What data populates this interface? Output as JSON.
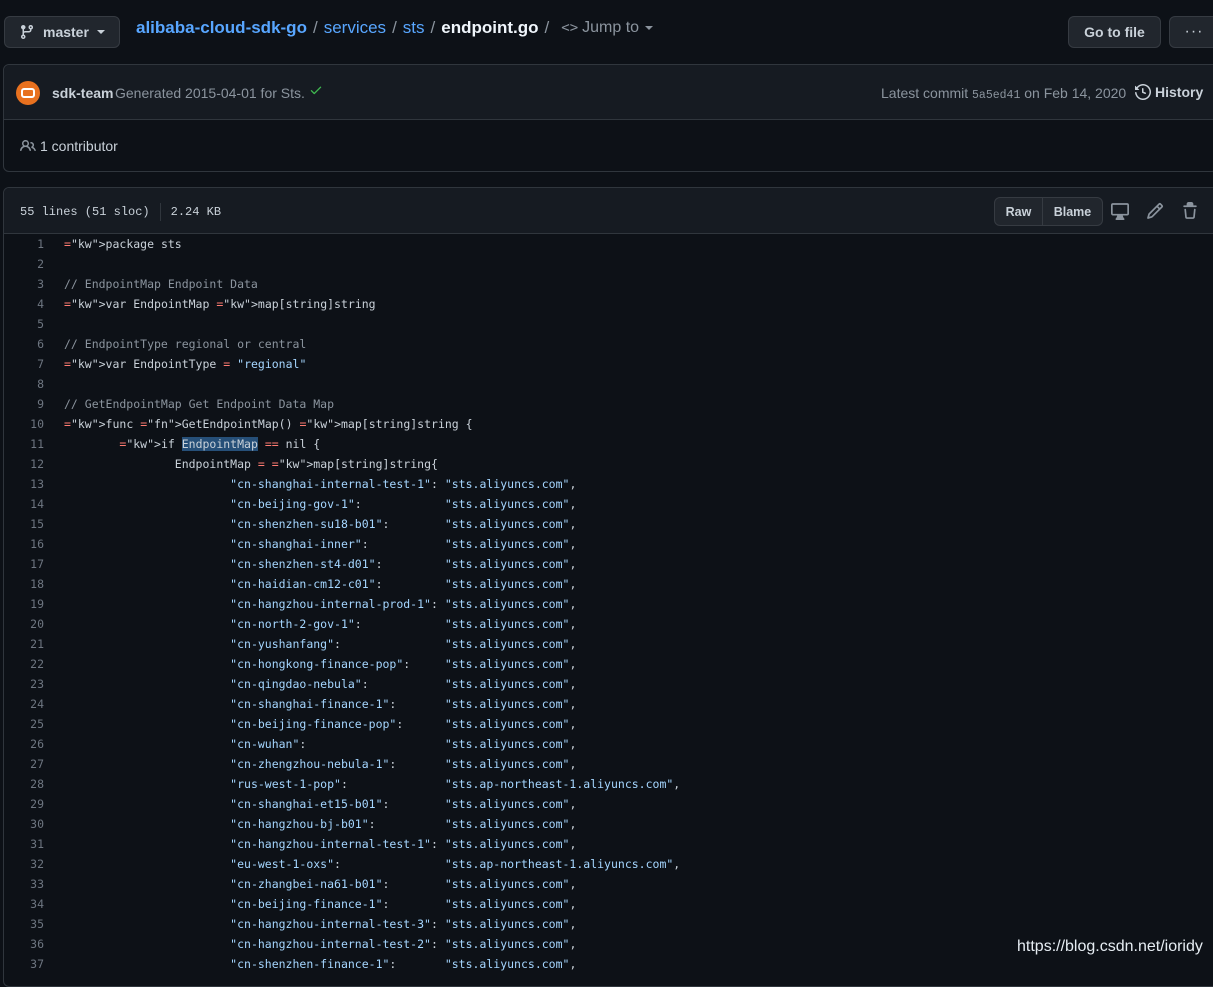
{
  "branch": {
    "label": "master"
  },
  "breadcrumb": {
    "repo": "alibaba-cloud-sdk-go",
    "path1": "services",
    "path2": "sts",
    "file": "endpoint.go",
    "jump_label": "Jump to"
  },
  "actions": {
    "go_to_file": "Go to file",
    "more": "···"
  },
  "commit": {
    "author": "sdk-team",
    "message": "Generated 2015-04-01 for Sts.",
    "latest_prefix": "Latest commit",
    "sha": "5a5ed41",
    "date_text": "on Feb 14, 2020",
    "history_label": "History"
  },
  "contributors": {
    "label": "1 contributor"
  },
  "file": {
    "lines_info": "55 lines (51 sloc)",
    "size": "2.24 KB",
    "raw_label": "Raw",
    "blame_label": "Blame"
  },
  "code_lines": [
    {
      "n": "1",
      "t": "package sts"
    },
    {
      "n": "2",
      "t": ""
    },
    {
      "n": "3",
      "t": "// EndpointMap Endpoint Data"
    },
    {
      "n": "4",
      "t": "var EndpointMap map[string]string"
    },
    {
      "n": "5",
      "t": ""
    },
    {
      "n": "6",
      "t": "// EndpointType regional or central"
    },
    {
      "n": "7",
      "t": "var EndpointType = \"regional\""
    },
    {
      "n": "8",
      "t": ""
    },
    {
      "n": "9",
      "t": "// GetEndpointMap Get Endpoint Data Map"
    },
    {
      "n": "10",
      "t": "func GetEndpointMap() map[string]string {"
    },
    {
      "n": "11",
      "t": "        if EndpointMap == nil {"
    },
    {
      "n": "12",
      "t": "                EndpointMap = map[string]string{"
    },
    {
      "n": "13",
      "t": "                        \"cn-shanghai-internal-test-1\": \"sts.aliyuncs.com\","
    },
    {
      "n": "14",
      "t": "                        \"cn-beijing-gov-1\":            \"sts.aliyuncs.com\","
    },
    {
      "n": "15",
      "t": "                        \"cn-shenzhen-su18-b01\":        \"sts.aliyuncs.com\","
    },
    {
      "n": "16",
      "t": "                        \"cn-shanghai-inner\":           \"sts.aliyuncs.com\","
    },
    {
      "n": "17",
      "t": "                        \"cn-shenzhen-st4-d01\":         \"sts.aliyuncs.com\","
    },
    {
      "n": "18",
      "t": "                        \"cn-haidian-cm12-c01\":         \"sts.aliyuncs.com\","
    },
    {
      "n": "19",
      "t": "                        \"cn-hangzhou-internal-prod-1\": \"sts.aliyuncs.com\","
    },
    {
      "n": "20",
      "t": "                        \"cn-north-2-gov-1\":            \"sts.aliyuncs.com\","
    },
    {
      "n": "21",
      "t": "                        \"cn-yushanfang\":               \"sts.aliyuncs.com\","
    },
    {
      "n": "22",
      "t": "                        \"cn-hongkong-finance-pop\":     \"sts.aliyuncs.com\","
    },
    {
      "n": "23",
      "t": "                        \"cn-qingdao-nebula\":           \"sts.aliyuncs.com\","
    },
    {
      "n": "24",
      "t": "                        \"cn-shanghai-finance-1\":       \"sts.aliyuncs.com\","
    },
    {
      "n": "25",
      "t": "                        \"cn-beijing-finance-pop\":      \"sts.aliyuncs.com\","
    },
    {
      "n": "26",
      "t": "                        \"cn-wuhan\":                    \"sts.aliyuncs.com\","
    },
    {
      "n": "27",
      "t": "                        \"cn-zhengzhou-nebula-1\":       \"sts.aliyuncs.com\","
    },
    {
      "n": "28",
      "t": "                        \"rus-west-1-pop\":              \"sts.ap-northeast-1.aliyuncs.com\","
    },
    {
      "n": "29",
      "t": "                        \"cn-shanghai-et15-b01\":        \"sts.aliyuncs.com\","
    },
    {
      "n": "30",
      "t": "                        \"cn-hangzhou-bj-b01\":          \"sts.aliyuncs.com\","
    },
    {
      "n": "31",
      "t": "                        \"cn-hangzhou-internal-test-1\": \"sts.aliyuncs.com\","
    },
    {
      "n": "32",
      "t": "                        \"eu-west-1-oxs\":               \"sts.ap-northeast-1.aliyuncs.com\","
    },
    {
      "n": "33",
      "t": "                        \"cn-zhangbei-na61-b01\":        \"sts.aliyuncs.com\","
    },
    {
      "n": "34",
      "t": "                        \"cn-beijing-finance-1\":        \"sts.aliyuncs.com\","
    },
    {
      "n": "35",
      "t": "                        \"cn-hangzhou-internal-test-3\": \"sts.aliyuncs.com\","
    },
    {
      "n": "36",
      "t": "                        \"cn-hangzhou-internal-test-2\": \"sts.aliyuncs.com\","
    },
    {
      "n": "37",
      "t": "                        \"cn-shenzhen-finance-1\":       \"sts.aliyuncs.com\","
    }
  ],
  "watermark": "https://blog.csdn.net/ioridy",
  "colors": {
    "background": "#0d1117",
    "link": "#58a6ff",
    "keyword": "#ff7b72",
    "function": "#d2a8ff",
    "string": "#a5d6ff",
    "comment": "#8b949e"
  }
}
